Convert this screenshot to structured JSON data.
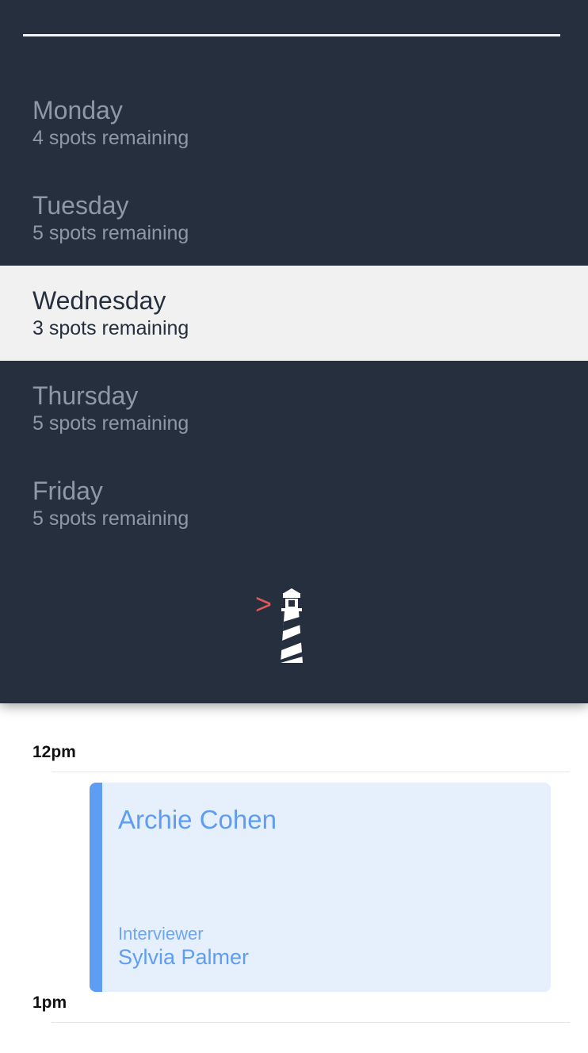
{
  "days": [
    {
      "name": "Monday",
      "spots": "4 spots remaining",
      "selected": false
    },
    {
      "name": "Tuesday",
      "spots": "5 spots remaining",
      "selected": false
    },
    {
      "name": "Wednesday",
      "spots": "3 spots remaining",
      "selected": true
    },
    {
      "name": "Thursday",
      "spots": "5 spots remaining",
      "selected": false
    },
    {
      "name": "Friday",
      "spots": "5 spots remaining",
      "selected": false
    }
  ],
  "logo": {
    "icon": "lighthouse-icon",
    "prompt_glyph": ">"
  },
  "schedule": {
    "times": [
      "12pm",
      "1pm"
    ],
    "event": {
      "title": "Archie Cohen",
      "role_label": "Interviewer",
      "person": "Sylvia Palmer"
    }
  },
  "colors": {
    "drawer_bg": "#262f3e",
    "selected_bg": "#f1f1f1",
    "accent": "#5e9df2",
    "event_bg": "#e6effc",
    "logo_accent": "#e05a5a"
  }
}
